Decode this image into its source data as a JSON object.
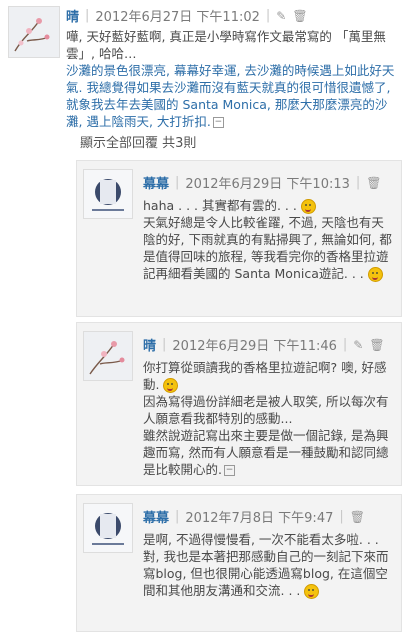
{
  "main_comment": {
    "author": "晴",
    "timestamp": "2012年6月27日 下午11:02",
    "separator": "|",
    "line1": "嘩, 天好藍好藍啊, 真正是小學時寫作文最常寫的 「萬里無雲」, 哈哈…",
    "line2": "沙灘的景色很漂亮, 幕幕好幸運, 去沙灘的時候遇上如此好天氣. 我總覺得如果去沙灘而沒有藍天就真的很可惜很遺憾了, 就象我去年去美國的 Santa Monica, 那麼大那麼漂亮的沙灘, 遇上陰雨天, 大打折扣."
  },
  "toggle_replies": "顯示全部回覆 共3則",
  "replies": [
    {
      "author": "幕幕",
      "timestamp": "2012年6月29日 下午10:13",
      "text1": "haha . . . 其實都有雲的. . .",
      "text2": "天氣好總是令人比較雀躍, 不過, 天陰也有天陰的好, 下雨就真的有點掃興了, 無論如何, 都是值得回味的旅程, 等我看完你的香格里拉遊記再細看美國的 Santa Monica遊記. . ."
    },
    {
      "author": "晴",
      "timestamp": "2012年6月29日 下午11:46",
      "text1": "你打算從頭讀我的香格里拉遊記啊? 噢, 好感動.",
      "text2": "因為寫得過份詳細老是被人取笑, 所以每次有人願意看我都特別的感動...",
      "text3": "雖然說遊記寫出來主要是做一個記錄, 是為興趣而寫, 然而有人願意看是一種鼓勵和認同總是比較開心的."
    },
    {
      "author": "幕幕",
      "timestamp": "2012年7月8日 下午9:47",
      "text1": "是啊, 不過得慢慢看, 一次不能看太多啦. . .",
      "text2": "對, 我也是本著把那感動自己的一刻記下來而寫blog, 但也很開心能透過寫blog, 在這個空間和其他朋友溝通和交流. . ."
    }
  ],
  "icons": {
    "edit": "pencil-icon",
    "delete": "trash-icon",
    "collapse": "collapse-icon",
    "emoji": "smiley-icon"
  }
}
